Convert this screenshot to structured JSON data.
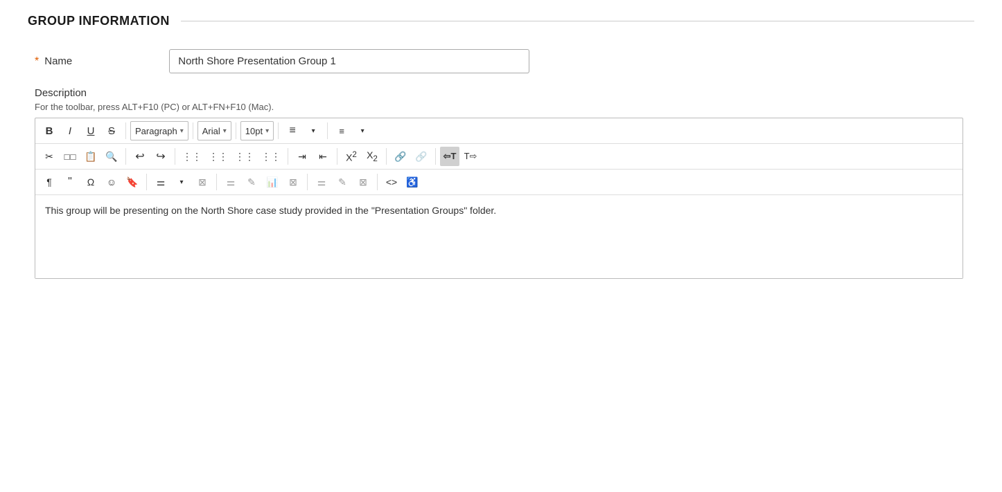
{
  "header": {
    "title": "GROUP INFORMATION"
  },
  "form": {
    "name_label": "Name",
    "required_star": "*",
    "name_value": "North Shore Presentation Group 1",
    "description_label": "Description",
    "toolbar_hint": "For the toolbar, press ALT+F10 (PC) or ALT+FN+F10 (Mac).",
    "editor_content": "This group will be presenting on the North Shore case study provided in the \"Presentation Groups\" folder."
  },
  "toolbar": {
    "row1": {
      "bold": "B",
      "italic": "I",
      "underline": "U",
      "strikethrough": "S",
      "paragraph_label": "Paragraph",
      "font_label": "Arial",
      "size_label": "10pt",
      "list_unordered": "☰",
      "list_ordered": "≡"
    },
    "row2": {
      "cut": "✂",
      "copy": "⧉",
      "paste": "📋",
      "find": "🔍",
      "undo": "↩",
      "redo": "↪",
      "align_left": "≡",
      "align_center": "≡",
      "align_right": "≡",
      "align_justify": "≡",
      "indent": "⇥",
      "outdent": "⇤",
      "superscript": "X²",
      "subscript": "X₂",
      "link": "🔗",
      "unlink": "⛓",
      "ltr": "⇐T",
      "rtl": "T⇒"
    },
    "row3": {
      "show_blocks": "¶",
      "quote": "❝",
      "special_char": "Ω",
      "emoji": "☺",
      "bookmark": "🔖",
      "table": "▦",
      "source": "<>"
    }
  },
  "colors": {
    "accent": "#e05c00",
    "active_btn_bg": "#d0d0d0",
    "border": "#bbb"
  }
}
